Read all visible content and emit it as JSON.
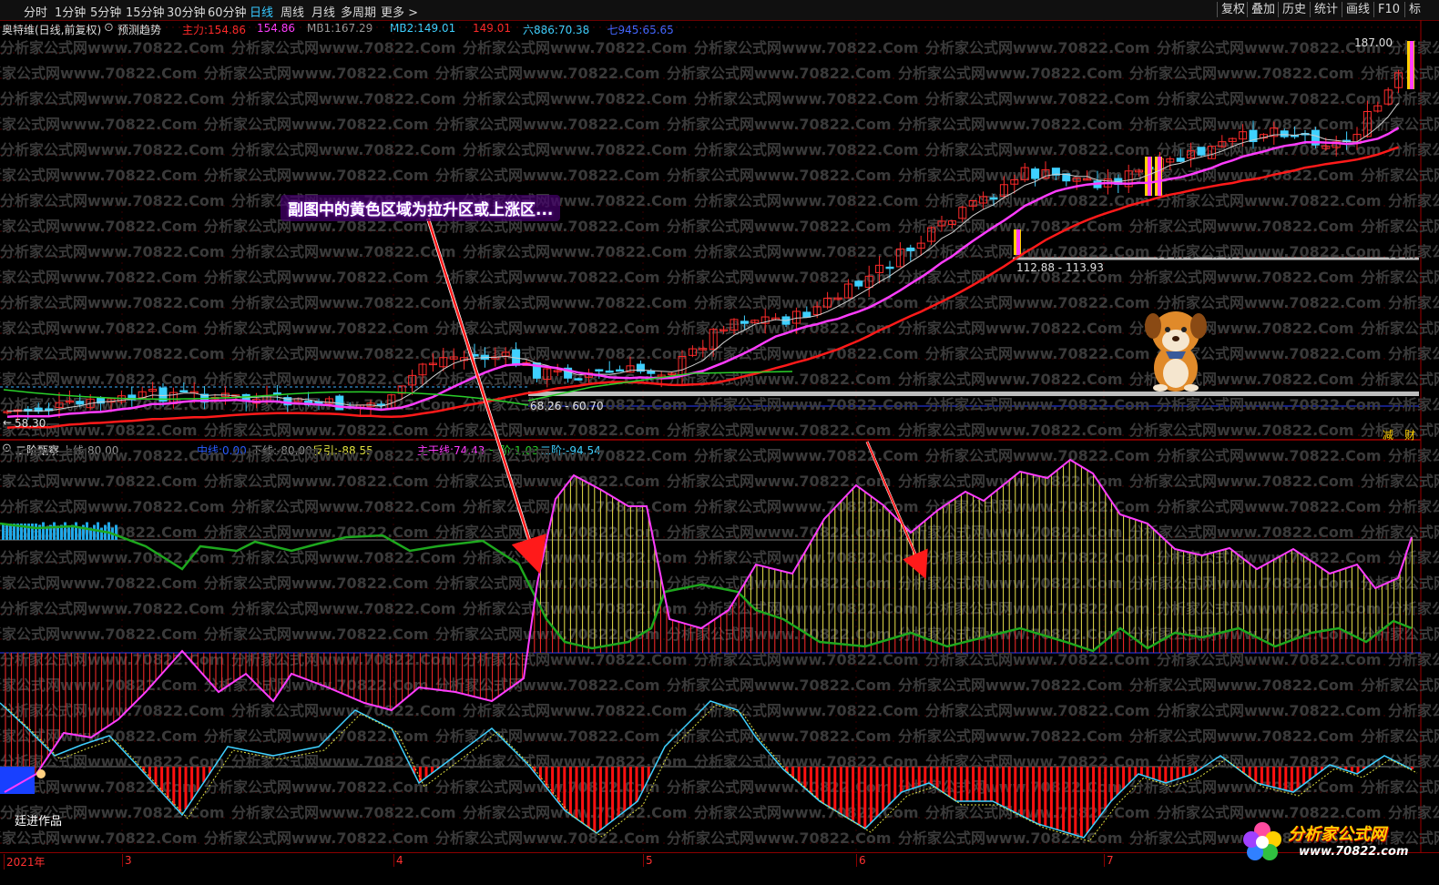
{
  "toolbar": {
    "periods": [
      "分时",
      "1分钟",
      "5分钟",
      "15分钟",
      "30分钟",
      "60分钟",
      "日线",
      "周线",
      "月线",
      "多周期",
      "更多 >"
    ],
    "active_period": "日线",
    "right_buttons": [
      "复权",
      "叠加",
      "历史",
      "统计",
      "画线",
      "F10",
      "标"
    ]
  },
  "main_chart": {
    "stock_title": "奥特维(日线,前复权)",
    "forecast_label": "预测趋势",
    "indicators": [
      {
        "label": "主力:",
        "value": "154.86",
        "color": "#ff2a2a"
      },
      {
        "label": "",
        "value": "154.86",
        "color": "#ff3cff"
      },
      {
        "label": "MB1:",
        "value": "167.29",
        "color": "#9a9a9a"
      },
      {
        "label": "MB2:",
        "value": "149.01",
        "color": "#3fd0ff"
      },
      {
        "label": "",
        "value": "149.01",
        "color": "#ff2a2a"
      },
      {
        "label": "六886:",
        "value": "70.38",
        "color": "#3fd0ff"
      },
      {
        "label": "七945:",
        "value": "65.65",
        "color": "#4466ff"
      }
    ],
    "high_label": "187.00",
    "low_label": "58.30",
    "range_label_1": "112.88 - 113.93",
    "range_label_2": "68.26 - 60.70",
    "annotation": "副图中的黄色区域为拉升区或上涨区..."
  },
  "sub_chart": {
    "title": "二阶甄察",
    "indicators": [
      {
        "label": "上线:",
        "value": "80.00",
        "color": "#9a9a9a"
      },
      {
        "label": "中线:",
        "value": "0.00",
        "color": "#2a5cff"
      },
      {
        "label": "下线:",
        "value": "-80.00",
        "color": "#9a9a9a"
      },
      {
        "label": "反引:",
        "value": "-88.55",
        "color": "#e0e040"
      },
      {
        "label": "主干线:",
        "value": "74.43",
        "color": "#ff3cff"
      },
      {
        "label": "一阶:",
        "value": "1.03",
        "color": "#2ad02a"
      },
      {
        "label": "二阶:",
        "value": "-94.54",
        "color": "#3fd0ff"
      }
    ],
    "author": "廷进作品",
    "right_tags": [
      "减",
      "财"
    ]
  },
  "date_axis": [
    "2021年",
    "3",
    "4",
    "5",
    "6",
    "7"
  ],
  "watermark": "分析家公式网www.70822.Com",
  "logo": {
    "text": "分析家公式网",
    "url": "www.70822.com"
  }
}
